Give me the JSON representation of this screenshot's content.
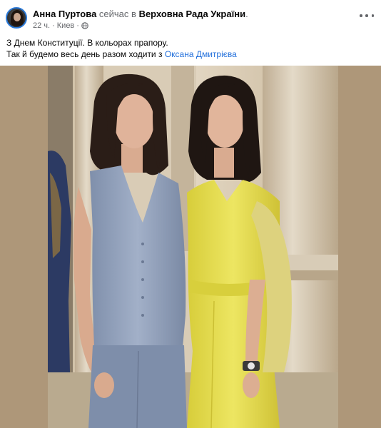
{
  "author": {
    "name": "Анна Пуртова",
    "action": "сейчас в",
    "place": "Верховна Рада України",
    "place_suffix": "."
  },
  "meta": {
    "time": "22 ч.",
    "separator": "·",
    "location": "Киев",
    "separator2": "·",
    "audience_icon": "globe-icon"
  },
  "post": {
    "line1": "З Днем Конституції. В кольорах прапору.",
    "line2_prefix": "Так й будемо весь день разом ходити з",
    "mention": "Оксана Дмитрієва"
  },
  "menu": {
    "icon": "more-options-icon"
  },
  "colors": {
    "link": "#216fdb",
    "secondary_text": "#65676b",
    "text": "#050505",
    "photo_border": "#ae9779",
    "vest_blue": "#8d9cb7",
    "dress_yellow": "#e6e04c"
  }
}
